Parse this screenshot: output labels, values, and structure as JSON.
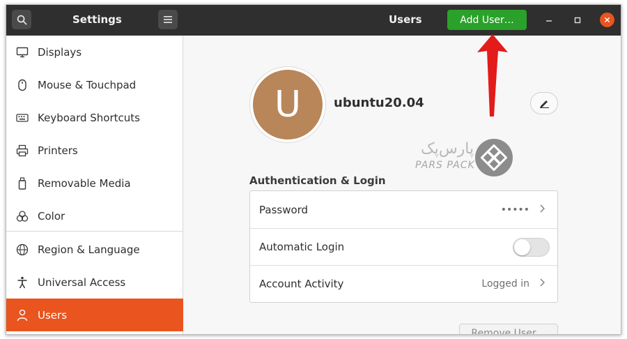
{
  "header": {
    "app_title": "Settings",
    "page_title": "Users",
    "add_user_label": "Add User…",
    "search_icon": "search-icon",
    "menu_icon": "hamburger-menu-icon",
    "window_controls": [
      "minimize",
      "maximize",
      "close"
    ]
  },
  "sidebar": {
    "items": [
      {
        "label": "Displays",
        "icon": "display-icon"
      },
      {
        "label": "Mouse & Touchpad",
        "icon": "mouse-icon"
      },
      {
        "label": "Keyboard Shortcuts",
        "icon": "keyboard-icon"
      },
      {
        "label": "Printers",
        "icon": "printer-icon"
      },
      {
        "label": "Removable Media",
        "icon": "removable-media-icon"
      },
      {
        "label": "Color",
        "icon": "color-icon"
      },
      {
        "label": "Region & Language",
        "icon": "globe-icon"
      },
      {
        "label": "Universal Access",
        "icon": "accessibility-icon"
      },
      {
        "label": "Users",
        "icon": "user-icon",
        "active": true
      }
    ]
  },
  "user": {
    "avatar_letter": "U",
    "username": "ubuntu20.04",
    "edit_icon": "pencil-icon"
  },
  "watermark": {
    "text_fa": "پارس‌پک",
    "text_en": "PARS PACK"
  },
  "auth": {
    "section_title": "Authentication & Login",
    "rows": [
      {
        "label": "Password",
        "value": "•••••"
      },
      {
        "label": "Automatic Login",
        "toggle": false
      },
      {
        "label": "Account Activity",
        "value": "Logged in"
      }
    ]
  },
  "actions": {
    "remove_user_label": "Remove User…"
  },
  "colors": {
    "accent": "#e9541f",
    "add_user_green": "#2aa12a",
    "titlebar": "#2f2f2f",
    "annotation_arrow": "#e31b1b"
  }
}
